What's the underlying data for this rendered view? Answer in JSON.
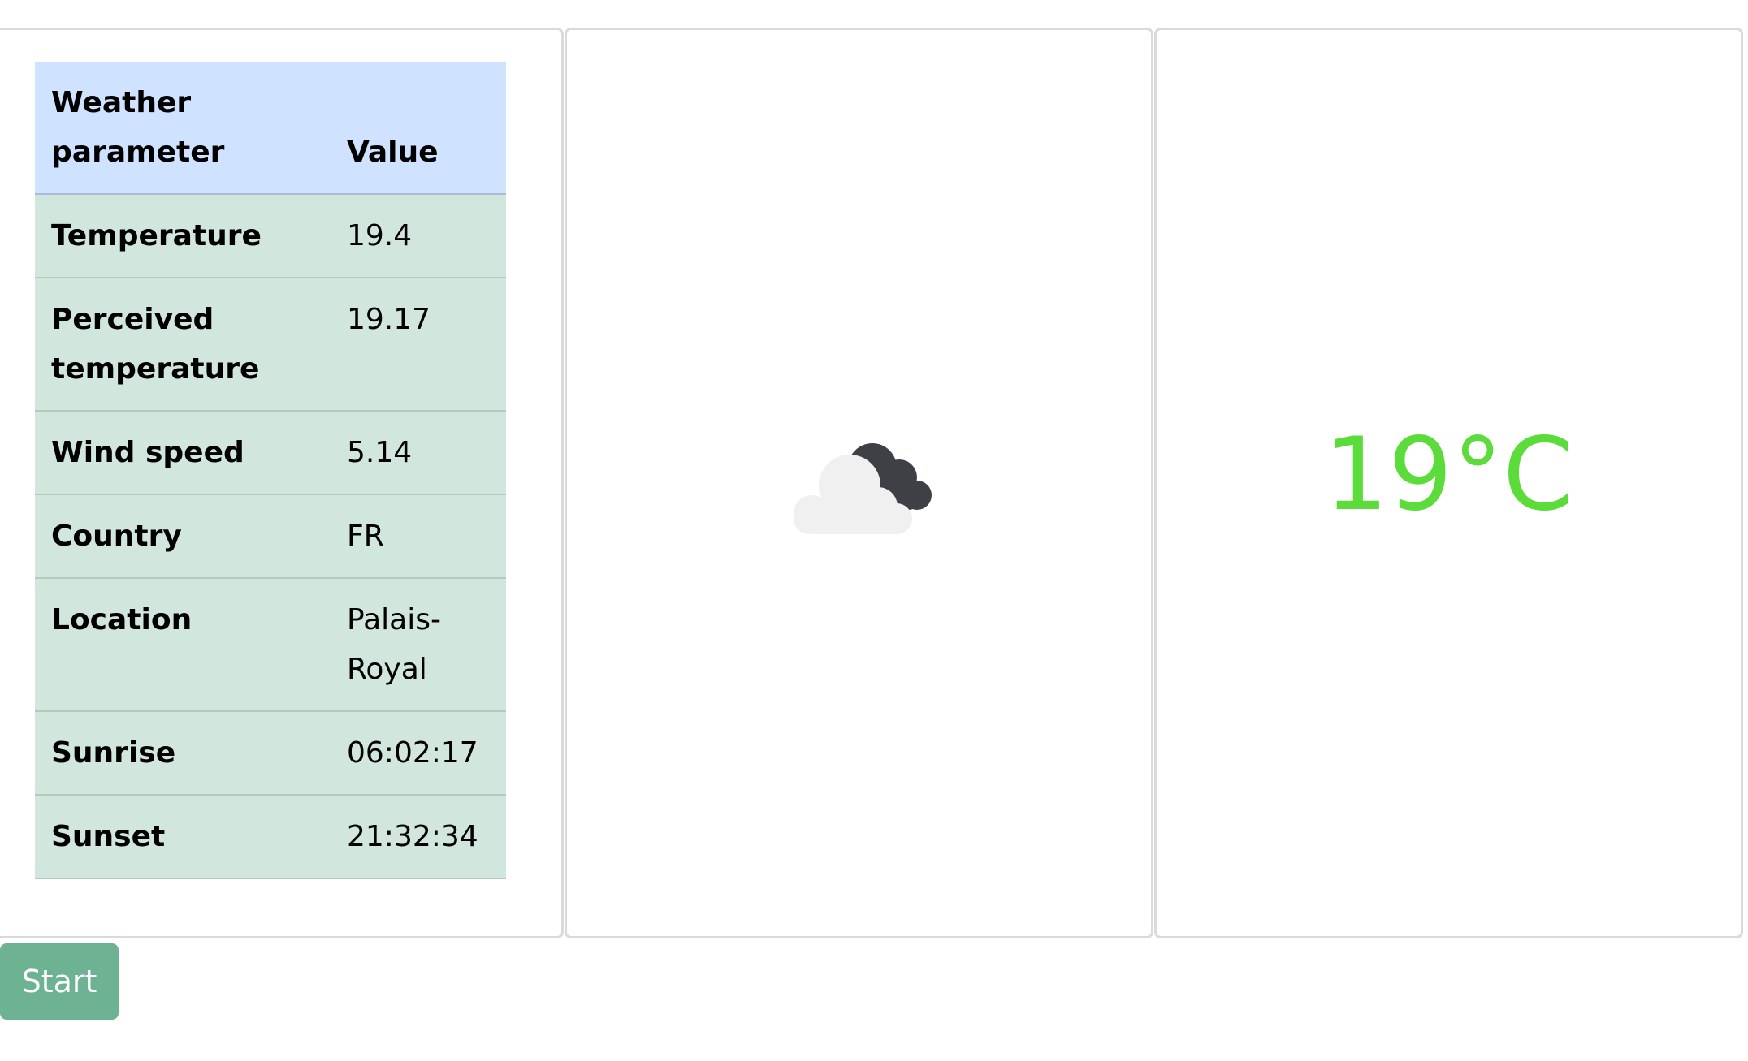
{
  "table": {
    "headers": {
      "parameter": "Weather parameter",
      "value": "Value"
    },
    "rows": [
      {
        "parameter": "Temperature",
        "value": "19.4"
      },
      {
        "parameter": "Perceived temperature",
        "value": "19.17"
      },
      {
        "parameter": "Wind speed",
        "value": "5.14"
      },
      {
        "parameter": "Country",
        "value": "FR"
      },
      {
        "parameter": "Location",
        "value": "Palais-Royal"
      },
      {
        "parameter": "Sunrise",
        "value": "06:02:17"
      },
      {
        "parameter": "Sunset",
        "value": "21:32:34"
      }
    ]
  },
  "weather_icon": {
    "name": "partly-cloudy-icon",
    "cloud_light_color": "#f0f0f0",
    "cloud_dark_color": "#3f4045"
  },
  "temperature_display": {
    "text": "19°C",
    "color": "#5bdc3a"
  },
  "start_button": {
    "label": "Start",
    "color": "#6db393"
  }
}
